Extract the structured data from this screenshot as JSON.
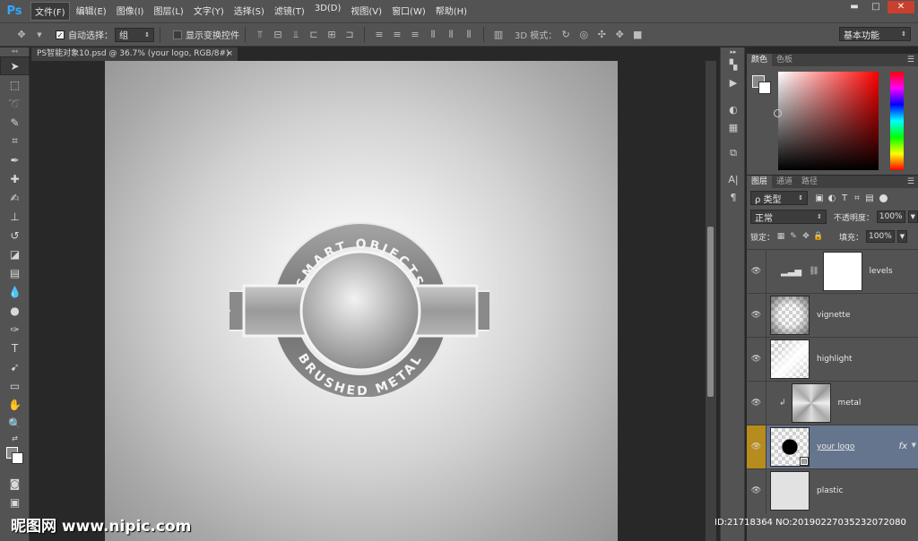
{
  "app": {
    "logo": "Ps"
  },
  "menu": [
    "文件(F)",
    "编辑(E)",
    "图像(I)",
    "图层(L)",
    "文字(Y)",
    "选择(S)",
    "滤镜(T)",
    "3D(D)",
    "视图(V)",
    "窗口(W)",
    "帮助(H)"
  ],
  "window_controls": {
    "minimize": "▬",
    "restore": "□",
    "close": "✕"
  },
  "options": {
    "auto_select_label": "自动选择：",
    "auto_select_value": "组",
    "show_transform_label": "显示变换控件",
    "mode_3d_label": "3D 模式：",
    "workspace": "基本功能"
  },
  "document": {
    "tab_title": "PS智能对象10.psd @ 36.7% (your logo, RGB/8#)",
    "close": "×"
  },
  "canvas": {
    "badge_top": "SMART OBJECTS",
    "badge_bottom": "BRUSHED METAL"
  },
  "color_panel": {
    "tabs": [
      "颜色",
      "色板"
    ]
  },
  "layers_panel": {
    "tabs": [
      "图层",
      "通道",
      "路径"
    ],
    "filter_type": "ρ 类型",
    "blend_mode": "正常",
    "opacity_label": "不透明度：",
    "opacity_value": "100%",
    "lock_label": "锁定：",
    "fill_label": "填充：",
    "fill_value": "100%",
    "layers": [
      {
        "name": "levels",
        "visible": true
      },
      {
        "name": "vignette",
        "visible": true
      },
      {
        "name": "highlight",
        "visible": true
      },
      {
        "name": "metal",
        "visible": true
      },
      {
        "name": "your logo",
        "visible": true,
        "active": true,
        "fx": "fx"
      },
      {
        "name": "plastic",
        "visible": true
      }
    ]
  },
  "watermark": {
    "site": "昵图网 www.nipic.com",
    "id": "ID:21718364 NO:20190227035232072080"
  },
  "colors": {
    "accent_blue": "#31a8ff",
    "active_layer": "#66758e",
    "eye_active": "#b78c1e"
  }
}
